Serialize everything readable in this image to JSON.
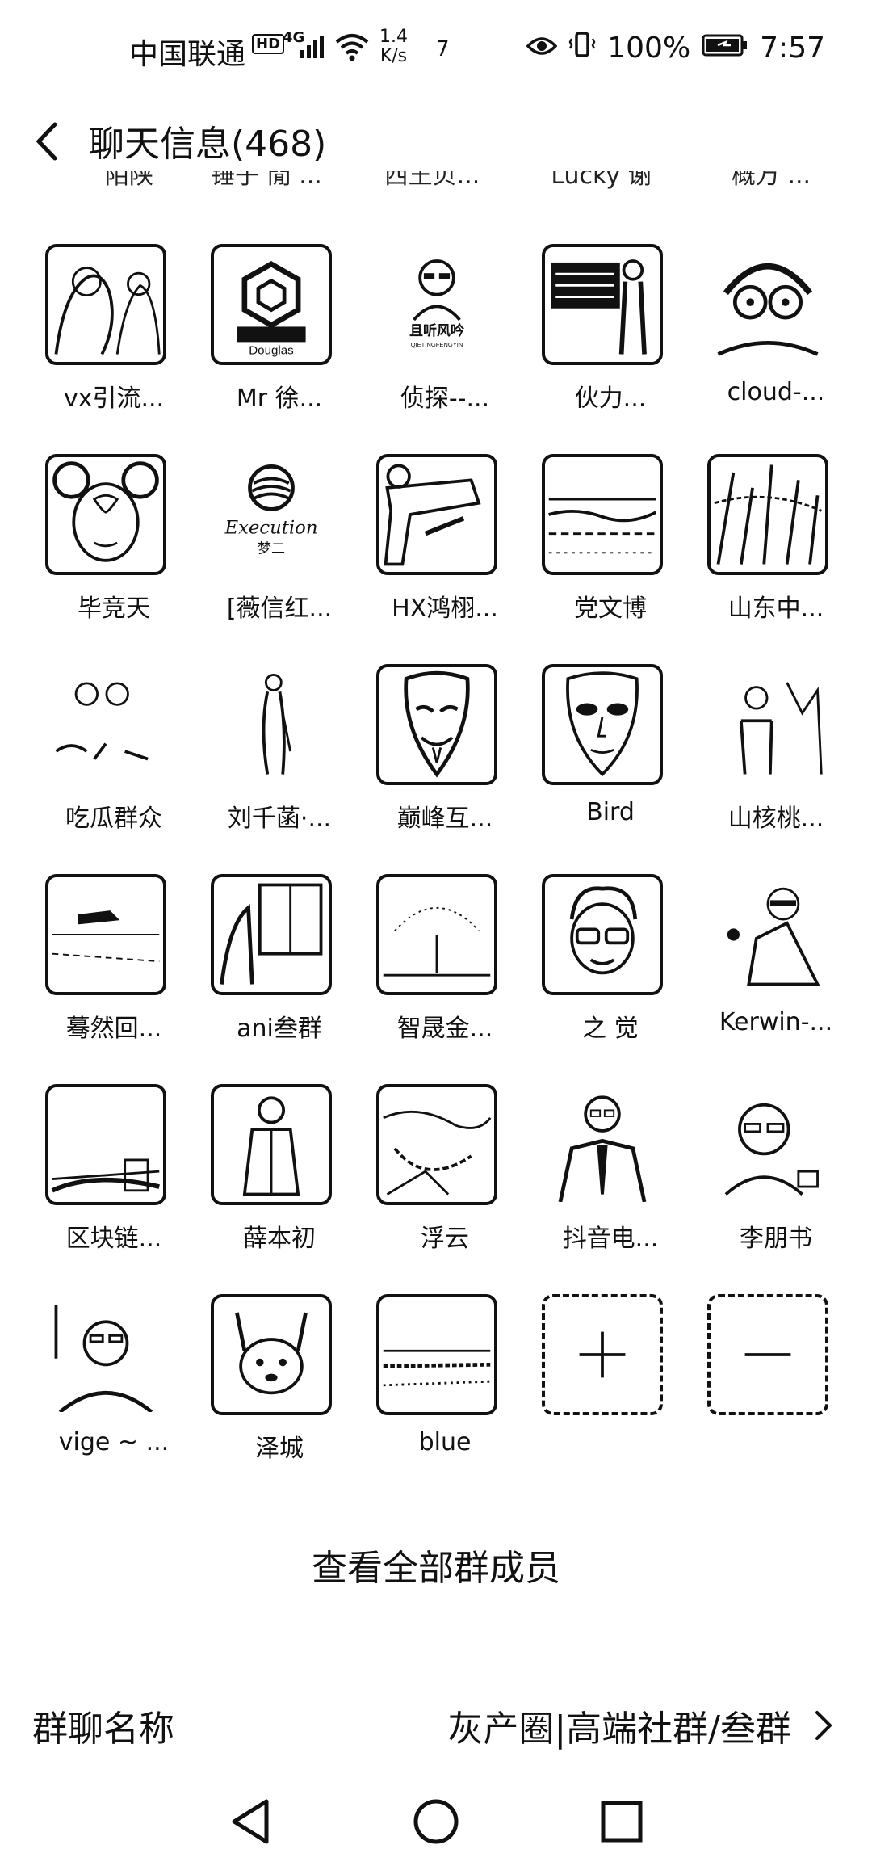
{
  "status_bar": {
    "carrier": "中国联通",
    "hd": "HD",
    "net": "4G",
    "speed_top": "1.4",
    "speed_bottom": "K/s",
    "notif_count": "7",
    "battery": "100%",
    "time": "7:57"
  },
  "header": {
    "title": "聊天信息(468)"
  },
  "partial_row": [
    "陌陕",
    "锤子 閒 ...",
    "西王贝...",
    "Lucky 谢",
    "概万 ..."
  ],
  "members": [
    {
      "name": "vx引流...",
      "icon": "photo-people-avatar"
    },
    {
      "name": "Mr 徐...",
      "icon": "douglas-logo-avatar",
      "sub": "Douglas"
    },
    {
      "name": "侦探--...",
      "icon": "cartoon-man-avatar",
      "sub": "且听风吟",
      "sub2": "QIETINGFENGYIN"
    },
    {
      "name": "伙力...",
      "icon": "classroom-avatar"
    },
    {
      "name": "cloud-...",
      "icon": "glasses-cartoon-avatar"
    },
    {
      "name": "毕竞天",
      "icon": "child-avatar"
    },
    {
      "name": "[薇信红...",
      "icon": "execution-logo-avatar",
      "sub": "Execution",
      "sub2": "梦二"
    },
    {
      "name": "HX鸿栩...",
      "icon": "gun-avatar"
    },
    {
      "name": "党文博",
      "icon": "landscape-avatar"
    },
    {
      "name": "山东中...",
      "icon": "forest-avatar"
    },
    {
      "name": "吃瓜群众",
      "icon": "couple-photo-avatar"
    },
    {
      "name": "刘千菡·...",
      "icon": "woman-avatar"
    },
    {
      "name": "巅峰互...",
      "icon": "mask-avatar"
    },
    {
      "name": "Bird",
      "icon": "face-mask-avatar"
    },
    {
      "name": "山核桃...",
      "icon": "man-outdoor-avatar"
    },
    {
      "name": "蓦然回...",
      "icon": "car-photo-avatar"
    },
    {
      "name": "ani叁群",
      "icon": "window-avatar"
    },
    {
      "name": "智晟金...",
      "icon": "tree-avatar"
    },
    {
      "name": "之 觉",
      "icon": "cartoon-boy-avatar"
    },
    {
      "name": "Kerwin-...",
      "icon": "sunglasses-man-avatar"
    },
    {
      "name": "区块链...",
      "icon": "room-avatar"
    },
    {
      "name": "薛本初",
      "icon": "standing-man-avatar"
    },
    {
      "name": "浮云",
      "icon": "cloud-sky-avatar"
    },
    {
      "name": "抖音电...",
      "icon": "suit-man-avatar"
    },
    {
      "name": "李朋书",
      "icon": "portrait-man-avatar"
    },
    {
      "name": "vige ~ ...",
      "icon": "selfie-avatar"
    },
    {
      "name": "泽城",
      "icon": "dog-avatar"
    },
    {
      "name": "blue",
      "icon": "sea-avatar"
    }
  ],
  "actions": {
    "add": "add-member-icon",
    "remove": "remove-member-icon"
  },
  "view_all": "查看全部群成员",
  "group_name": {
    "label": "群聊名称",
    "value": "灰产圈|高端社群/叁群"
  },
  "nav": [
    "back-triangle-icon",
    "home-circle-icon",
    "recents-square-icon"
  ]
}
